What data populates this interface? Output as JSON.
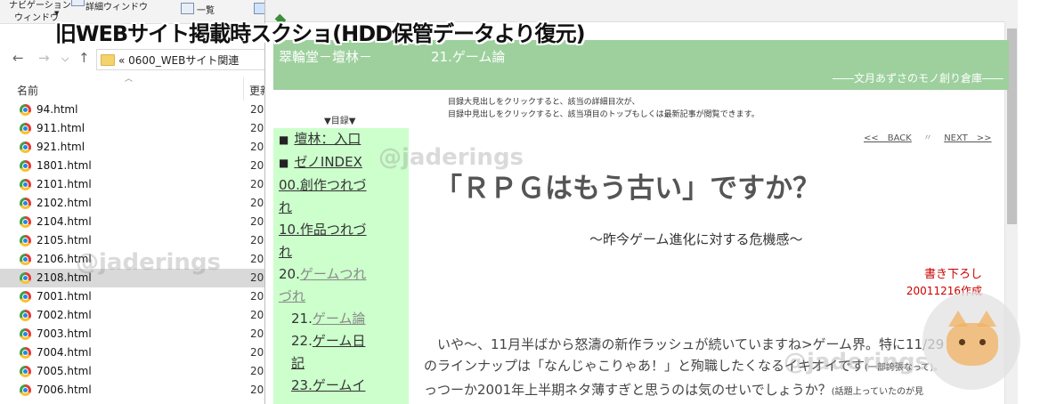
{
  "caption": "旧WEBサイト掲載時スクショ(HDD保管データより復元)",
  "explorer": {
    "ribbon": {
      "nav_pane_line1": "ナビゲーション",
      "nav_pane_line2": "ウィンドウ",
      "detail_window": "詳細ウィンドウ",
      "list_view": "一覧"
    },
    "nav": {
      "back": "←",
      "forward": "→",
      "dropdown": "⌵",
      "up": "↑"
    },
    "address": "«  0600_WEBサイト関連",
    "columns": {
      "name": "名前",
      "updated": "更新"
    },
    "files": [
      {
        "name": "94.html",
        "date": "200"
      },
      {
        "name": "911.html",
        "date": "200"
      },
      {
        "name": "921.html",
        "date": "200"
      },
      {
        "name": "1801.html",
        "date": "200"
      },
      {
        "name": "2101.html",
        "date": "200"
      },
      {
        "name": "2102.html",
        "date": "200"
      },
      {
        "name": "2104.html",
        "date": "200"
      },
      {
        "name": "2105.html",
        "date": "200"
      },
      {
        "name": "2106.html",
        "date": "200"
      },
      {
        "name": "2108.html",
        "date": "200"
      },
      {
        "name": "7001.html",
        "date": "200"
      },
      {
        "name": "7002.html",
        "date": "200"
      },
      {
        "name": "7003.html",
        "date": "200"
      },
      {
        "name": "7004.html",
        "date": "200"
      },
      {
        "name": "7005.html",
        "date": "200"
      },
      {
        "name": "7006.html",
        "date": "200"
      }
    ],
    "selected_index": 9
  },
  "site": {
    "title": "翠輪堂－壇林－",
    "section": "21.ゲーム論",
    "tagline": "――文月あずさのモノ創り倉庫――",
    "notice_line1": "目録大見出しをクリックすると、該当の詳細目次が、",
    "notice_line2": "目録中見出しをクリックすると、該当項目のトップもしくは最新記事が閲覧できます。",
    "toc_label": "▼目録▼",
    "sidebar": {
      "item1": "壇林：入口",
      "item2": "ゼノINDEX",
      "item3_line1": "00.創作つれづ",
      "item3_line2": "れ",
      "item4_line1": "10.作品つれづ",
      "item4_line2": "れ",
      "item5_prefix": "20.",
      "item5_line1": "ゲームつれ",
      "item5_line2": "づれ",
      "sub1_prefix": "21.",
      "sub1_label": "ゲーム論",
      "sub2_prefix": "22.",
      "sub2_line1": "ゲーム日",
      "sub2_line2": "記",
      "sub3_label": "23.ゲームイ"
    },
    "pager": {
      "back": "<<　BACK",
      "sep": "〃",
      "next": "NEXT　>>"
    }
  },
  "article": {
    "title": "「ＲＰＧはもう古い」ですか？",
    "subtitle": "～昨今ゲーム進化に対する危機感～",
    "meta_line1": "書き下ろし",
    "meta_line2": "20011216作成",
    "body_line1": "　いや～、11月半ばから怒濤の新作ラッシュが続いていますね>ゲーム界。特に11/29",
    "body_line2a": "のラインナップは「なんじゃこりゃあ！」と殉職したくなるイキオイです",
    "body_line2b": "(一部誇張なって)。",
    "body_line3a": "っつーか2001年上半期ネタ薄すぎと思うのは気のせいでしょうか？",
    "body_line3b": "(話題上っていたのが見"
  },
  "watermarks": [
    "@jaderings",
    "@jaderings",
    "@jaderings"
  ]
}
